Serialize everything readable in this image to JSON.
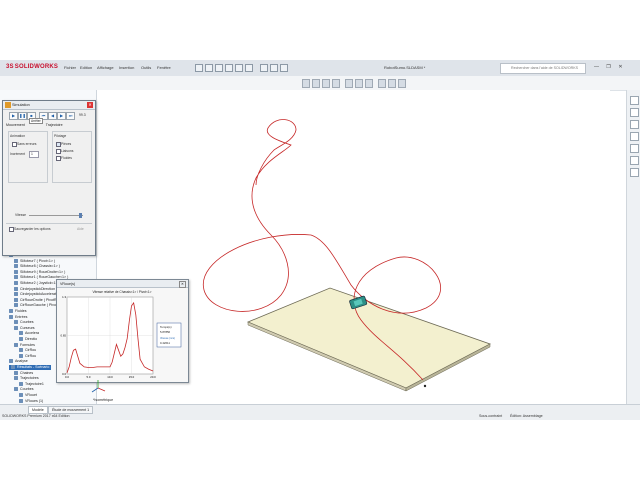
{
  "window": {
    "app_name": "SOLIDWORKS",
    "menu": [
      "Fichier",
      "Edition",
      "Affichage",
      "Insertion",
      "Outils",
      "Fenêtre"
    ],
    "doc_title": "RobotSumo.SLDASM *",
    "search_placeholder": "Rechercher dans l'aide de SOLIDWORKS",
    "buttons": [
      "—",
      "❐",
      "✕"
    ]
  },
  "tree": {
    "items": [
      {
        "label": "Efforts",
        "indent": 1,
        "style": "normal"
      },
      {
        "label": "SMoteur7 ( Pivot<1> )",
        "indent": 2,
        "style": "normal"
      },
      {
        "label": "SMoteur8 ( Chassis<1> )",
        "indent": 2,
        "style": "normal"
      },
      {
        "label": "SMoteur9 ( RoueDroite<1> )",
        "indent": 2,
        "style": "normal"
      },
      {
        "label": "SMoteur1 ( RoueGauche<1> )",
        "indent": 2,
        "style": "normal"
      },
      {
        "label": "SMoteur2 ( Joystick<1> )",
        "indent": 2,
        "style": "normal"
      },
      {
        "label": "CirclejoystickDirection ( Joystick )",
        "indent": 2,
        "style": "normal"
      },
      {
        "label": "CirclejoystickAcceleration ( Joy",
        "indent": 2,
        "style": "normal"
      },
      {
        "label": "CirRoueDroite ( PivotRoueDroite",
        "indent": 2,
        "style": "normal"
      },
      {
        "label": "CirRoueGauche ( PivotRoueGauch",
        "indent": 2,
        "style": "normal"
      },
      {
        "label": "Fluides",
        "indent": 1,
        "style": "normal"
      },
      {
        "label": "Entrées",
        "indent": 1,
        "style": "normal"
      },
      {
        "label": "Courbes",
        "indent": 2,
        "style": "normal"
      },
      {
        "label": "Curseurs",
        "indent": 2,
        "style": "normal"
      },
      {
        "label": "Accelera",
        "indent": 3,
        "style": "normal"
      },
      {
        "label": "Directio",
        "indent": 3,
        "style": "normal"
      },
      {
        "label": "Formules",
        "indent": 2,
        "style": "normal"
      },
      {
        "label": "CirRou",
        "indent": 3,
        "style": "normal"
      },
      {
        "label": "CirRou",
        "indent": 3,
        "style": "normal"
      },
      {
        "label": "Analyse",
        "indent": 1,
        "style": "normal"
      },
      {
        "label": "Résultats - Scénario",
        "indent": 1,
        "style": "hl"
      },
      {
        "label": "Chaines",
        "indent": 2,
        "style": "normal"
      },
      {
        "label": "Trajectoires",
        "indent": 2,
        "style": "normal"
      },
      {
        "label": "Trajectoire1",
        "indent": 3,
        "style": "normal"
      },
      {
        "label": "Courbes",
        "indent": 2,
        "style": "normal"
      },
      {
        "label": "VRouet",
        "indent": 3,
        "style": "normal"
      },
      {
        "label": "VRoues (1)",
        "indent": 3,
        "style": "normal"
      },
      {
        "label": "gNPrise (1)",
        "indent": 3,
        "style": "normal"
      },
      {
        "label": "CirRoue (1)",
        "indent": 3,
        "style": "normal"
      },
      {
        "label": "RobotSumo SMeoPhy",
        "indent": 0,
        "style": "normal"
      },
      {
        "label": "Résultats brise Etude",
        "indent": 0,
        "style": "red"
      },
      {
        "label": "Courbes",
        "indent": 1,
        "style": "normal"
      }
    ]
  },
  "simulation": {
    "title": "Simulation",
    "tabs": [
      "Mouvement",
      "Trajectoire"
    ],
    "tooltip": "Arrêter",
    "counter": "99.3",
    "animation_label": "Animation",
    "animation_options": [
      "Sans erreurs"
    ],
    "increment_label": "Incrément",
    "increment_value": "1",
    "display_label": "Pilotage",
    "display_options": [
      "Pièces",
      "Liaisons",
      "Fluides"
    ],
    "speed_label": "Vitesse",
    "save_label": "Sauvegarder les options",
    "help_label": "Aide"
  },
  "graph": {
    "window_title": "VRoue(s)",
    "chart_title": "Vitesse relative de Chassis<1> / Pivot<1>",
    "readout_time_label": "Temps(s)",
    "readout_time_value": "5.87856",
    "readout_vitesse_label": "Vitesse (m/s)",
    "readout_vitesse_value": "0.42611"
  },
  "chart_data": {
    "type": "line",
    "title": "Vitesse relative de Chassis<1> / Pivot<1>",
    "xlabel": "",
    "ylabel": "",
    "xlim": [
      0,
      20
    ],
    "ylim": [
      0,
      1.3
    ],
    "xticks": [
      "0.0",
      "5.0",
      "10.0",
      "15.0",
      "20.0"
    ],
    "yticks": [
      "0.0",
      "0.65",
      "1.3"
    ],
    "series": [
      {
        "color": "#c62828",
        "x": [
          0.0,
          0.5,
          1.0,
          1.5,
          2.0,
          2.5,
          3.0,
          4.0,
          5.0,
          6.0,
          7.0,
          8.0,
          9.0,
          10.0,
          10.5,
          11.0,
          11.5,
          12.0,
          12.5,
          13.0,
          13.5,
          14.0,
          14.5,
          15.0,
          15.5,
          16.0,
          16.5,
          17.0,
          18.0,
          19.0,
          20.0
        ],
        "y": [
          0.02,
          0.12,
          0.28,
          0.4,
          0.42,
          0.3,
          0.18,
          0.12,
          0.11,
          0.11,
          0.12,
          0.12,
          0.12,
          0.12,
          0.2,
          0.35,
          0.5,
          0.4,
          0.3,
          0.34,
          0.45,
          0.6,
          0.9,
          1.15,
          1.2,
          1.0,
          0.6,
          0.25,
          0.12,
          0.08,
          0.05
        ]
      }
    ]
  },
  "statusbar": {
    "tabs": [
      "Modèle",
      "Étude de mouvement 1"
    ],
    "app_version": "SOLIDWORKS Premium 2017 x64 Edition",
    "status_underconstrained": "Sous-contraint",
    "status_mode": "Édition: Assemblage"
  },
  "triad_label": "*Isométrique",
  "colors": {
    "solidworks_red": "#c8102e",
    "trajectory_red": "#c62828",
    "highlight_blue": "#2f6db5",
    "plate_fill": "#f3f0cf"
  }
}
